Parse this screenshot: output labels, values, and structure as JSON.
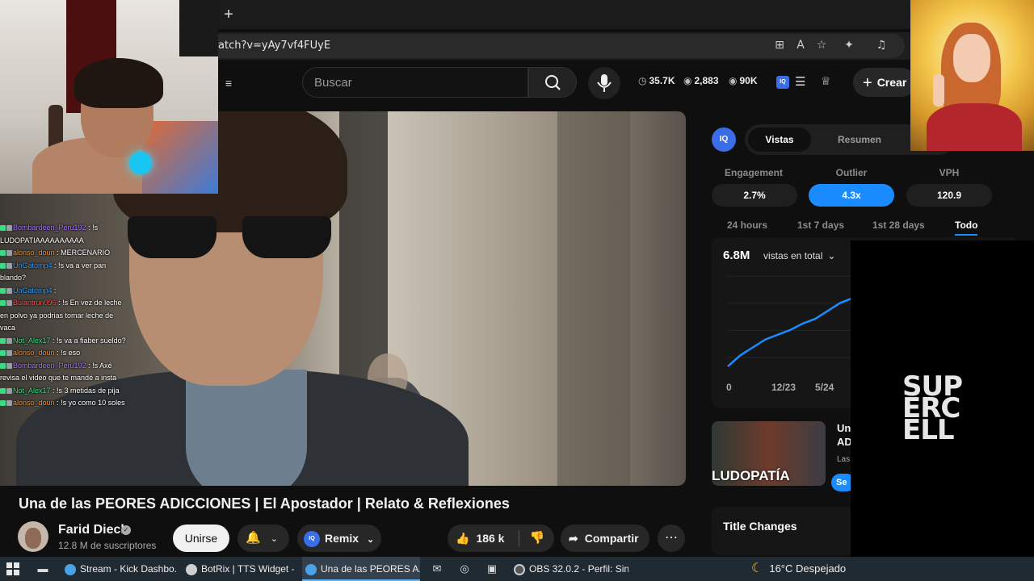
{
  "browser": {
    "new_tab_symbol": "+",
    "url": "atch?v=yAy7vf4FUyE"
  },
  "header": {
    "search_placeholder": "Buscar",
    "stats": [
      {
        "icon": "clock-icon",
        "value": "35.7K"
      },
      {
        "icon": "eye-icon",
        "value": "2,883"
      },
      {
        "icon": "eye-icon",
        "value": "90K"
      }
    ],
    "create_label": "Crear"
  },
  "video": {
    "title": "Una de las PEORES ADICCIONES | El Apostador | Relato & Reflexiones",
    "channel_name": "Farid Dieck",
    "subscribers": "12.8 M de suscriptores",
    "join_label": "Unirse",
    "remix_label": "Remix",
    "likes": "186 k",
    "share_label": "Compartir"
  },
  "chat": [
    {
      "user": "Bombardeen_Peru192",
      "color": "#a970ff",
      "text": "!s LUDOPATIAAAAAAAAAA"
    },
    {
      "user": "alonso_doun",
      "color": "#ff8c1a",
      "text": "MERCENARIO"
    },
    {
      "user": "UnGatomp4",
      "color": "#2e9cff",
      "text": "!s va a ver pan blando?"
    },
    {
      "user": "UnGatomp4",
      "color": "#2e9cff",
      "text": ""
    },
    {
      "user": "Bulantrun096",
      "color": "#ff4d4d",
      "text": "!s En vez de leche en polvo ya podrias tomar leche de vaca"
    },
    {
      "user": "Not_Alex17",
      "color": "#3ddc84",
      "text": "!s va a fiaber sueldo?"
    },
    {
      "user": "alonso_doun",
      "color": "#ff8c1a",
      "text": "!s eso"
    },
    {
      "user": "Bombardeen_Peru192",
      "color": "#a970ff",
      "text": "!s Axé revisa el video que te mandé a insta"
    },
    {
      "user": "Not_Alex17",
      "color": "#3ddc84",
      "text": "!s 3 metidas de pija"
    },
    {
      "user": "alonso_doun",
      "color": "#ff8c1a",
      "text": "!s yo como 10 soles"
    }
  ],
  "panel": {
    "logo_text": "IQ",
    "tabs": [
      "Vistas",
      "Resumen"
    ],
    "metrics": [
      {
        "label": "Engagement",
        "value": "2.7%"
      },
      {
        "label": "Outlier",
        "value": "4.3x"
      },
      {
        "label": "VPH",
        "value": "120.9"
      }
    ],
    "ranges": [
      "24 hours",
      "1st 7 days",
      "1st 28 days",
      "Todo"
    ],
    "total_value": "6.8M",
    "total_label": "vistas en total"
  },
  "chart_data": {
    "type": "line",
    "x_ticks": [
      "0",
      "12/23",
      "5/24"
    ],
    "series": [
      {
        "values": [
          0.3,
          1.0,
          1.5,
          2.0,
          2.3,
          2.6,
          3.0,
          3.3,
          3.8,
          4.3,
          4.6,
          4.8
        ]
      }
    ],
    "color": "#1a8cff",
    "grid": true
  },
  "related": {
    "thumb_text": "LUDOPATÍA",
    "title": "Un AD",
    "meta": "Las",
    "button_label": "Se"
  },
  "title_changes": {
    "label": "Title Changes"
  },
  "overlay_logo": [
    "SUP",
    "ERC",
    "ELL"
  ],
  "taskbar": {
    "apps": [
      {
        "label": "Stream - Kick Dashbo...",
        "color": "#4aa3e8"
      },
      {
        "label": "BotRix | TTS Widget - ...",
        "color": "#cfcfcf"
      },
      {
        "label": "Una de las PEORES A...",
        "color": "#4aa3e8"
      },
      {
        "label": "OBS 32.0.2 - Perfil: Sin...",
        "color": "#555"
      }
    ],
    "weather": "16°C  Despejado"
  }
}
